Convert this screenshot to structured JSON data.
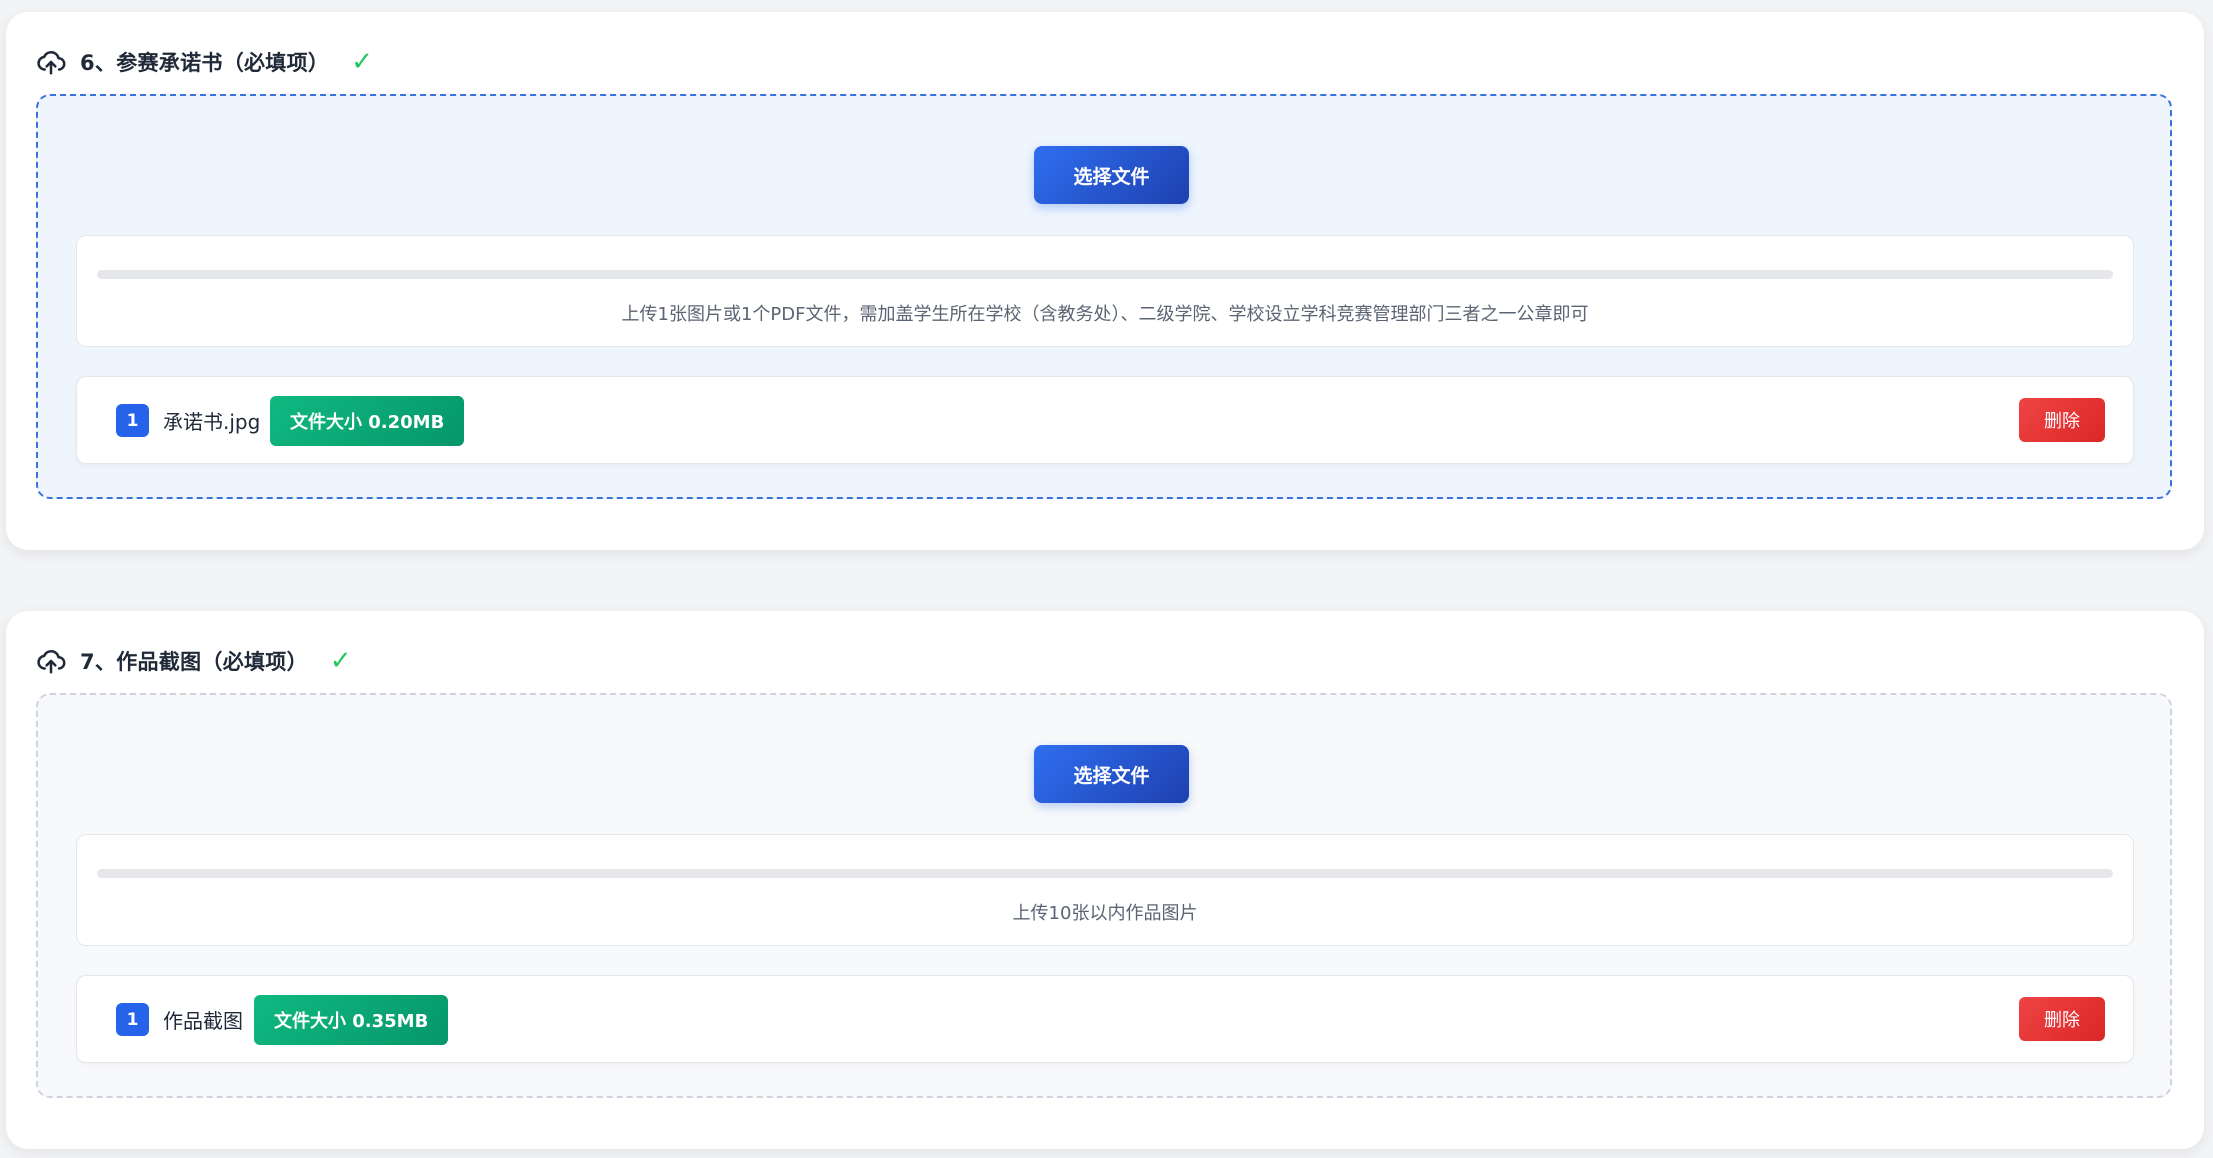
{
  "sections": [
    {
      "title": "6、参赛承诺书（必填项）",
      "status_icon": "check-icon",
      "status_symbol": "✓",
      "choose_button_label": "选择文件",
      "upload_progress": 0,
      "hint": "上传1张图片或1个PDF文件，需加盖学生所在学校（含教务处）、二级学院、学校设立学科竞赛管理部门三者之一公章即可",
      "files": [
        {
          "index": "1",
          "name": "承诺书.jpg",
          "size_label": "文件大小 0.20MB",
          "delete_label": "删除"
        }
      ]
    },
    {
      "title": "7、作品截图（必填项）",
      "status_icon": "check-icon",
      "status_symbol": "✓",
      "choose_button_label": "选择文件",
      "upload_progress": 0,
      "hint": "上传10张以内作品图片",
      "files": [
        {
          "index": "1",
          "name": "作品截图",
          "size_label": "文件大小 0.35MB",
          "delete_label": "删除"
        }
      ]
    }
  ],
  "colors": {
    "primary_button": "#2563eb",
    "size_badge": "#10b981",
    "delete_button": "#ef4444",
    "status_check": "#22c55e",
    "active_dropzone_border": "#3b72d9",
    "active_dropzone_bg": "#eef5fd"
  }
}
